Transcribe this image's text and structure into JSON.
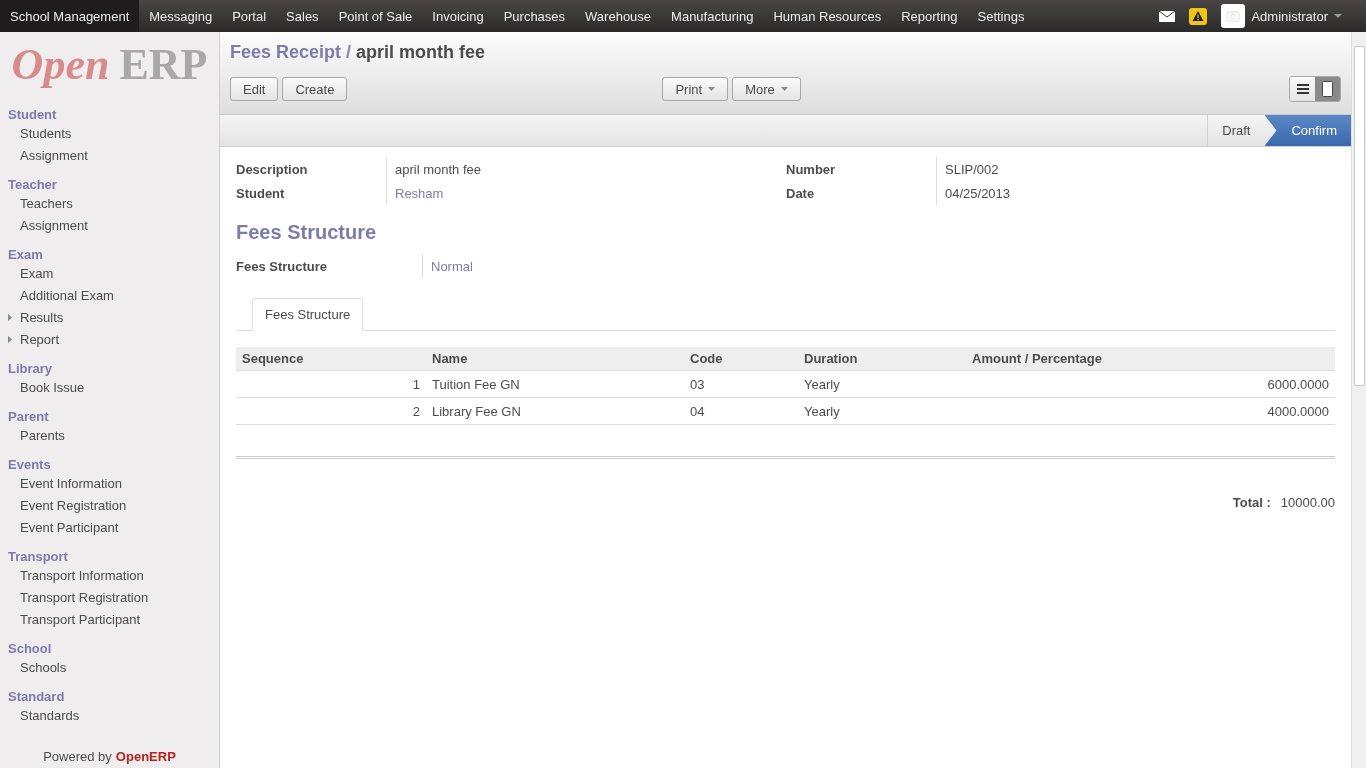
{
  "top_menu": [
    {
      "label": "School Management",
      "selected": true
    },
    {
      "label": "Messaging",
      "selected": false
    },
    {
      "label": "Portal",
      "selected": false
    },
    {
      "label": "Sales",
      "selected": false
    },
    {
      "label": "Point of Sale",
      "selected": false
    },
    {
      "label": "Invoicing",
      "selected": false
    },
    {
      "label": "Purchases",
      "selected": false
    },
    {
      "label": "Warehouse",
      "selected": false
    },
    {
      "label": "Manufacturing",
      "selected": false
    },
    {
      "label": "Human Resources",
      "selected": false
    },
    {
      "label": "Reporting",
      "selected": false
    },
    {
      "label": "Settings",
      "selected": false
    }
  ],
  "user": {
    "name": "Administrator"
  },
  "sidebar": {
    "logo_a": "Open",
    "logo_b": "ERP",
    "sections": [
      {
        "title": "Student",
        "items": [
          {
            "label": "Students",
            "expandable": false
          },
          {
            "label": "Assignment",
            "expandable": false
          }
        ]
      },
      {
        "title": "Teacher",
        "items": [
          {
            "label": "Teachers",
            "expandable": false
          },
          {
            "label": "Assignment",
            "expandable": false
          }
        ]
      },
      {
        "title": "Exam",
        "items": [
          {
            "label": "Exam",
            "expandable": false
          },
          {
            "label": "Additional Exam",
            "expandable": false
          },
          {
            "label": "Results",
            "expandable": true
          },
          {
            "label": "Report",
            "expandable": true
          }
        ]
      },
      {
        "title": "Library",
        "items": [
          {
            "label": "Book Issue",
            "expandable": false
          }
        ]
      },
      {
        "title": "Parent",
        "items": [
          {
            "label": "Parents",
            "expandable": false
          }
        ]
      },
      {
        "title": "Events",
        "items": [
          {
            "label": "Event Information",
            "expandable": false
          },
          {
            "label": "Event Registration",
            "expandable": false
          },
          {
            "label": "Event Participant",
            "expandable": false
          }
        ]
      },
      {
        "title": "Transport",
        "items": [
          {
            "label": "Transport Information",
            "expandable": false
          },
          {
            "label": "Transport Registration",
            "expandable": false
          },
          {
            "label": "Transport Participant",
            "expandable": false
          }
        ]
      },
      {
        "title": "School",
        "items": [
          {
            "label": "Schools",
            "expandable": false
          }
        ]
      },
      {
        "title": "Standard",
        "items": [
          {
            "label": "Standards",
            "expandable": false
          }
        ]
      }
    ],
    "footer_a": "Powered by",
    "footer_b": "OpenERP"
  },
  "breadcrumb": {
    "parent": "Fees Receipt",
    "separator": "/",
    "current": "april month fee"
  },
  "buttons_left": [
    "Edit",
    "Create"
  ],
  "buttons_mid": [
    "Print",
    "More"
  ],
  "view_switch": [
    {
      "kind": "list",
      "selected": false
    },
    {
      "kind": "form",
      "selected": true
    }
  ],
  "stages": [
    {
      "label": "Draft",
      "selected": false
    },
    {
      "label": "Confirm",
      "selected": true
    }
  ],
  "fields_left": [
    {
      "label": "Description",
      "value": "april month fee",
      "link": false
    },
    {
      "label": "Student",
      "value": "Resham",
      "link": true
    }
  ],
  "fields_right": [
    {
      "label": "Number",
      "value": "SLIP/002",
      "link": false
    },
    {
      "label": "Date",
      "value": "04/25/2013",
      "link": false
    }
  ],
  "section_title": "Fees Structure",
  "structure_field": {
    "label": "Fees Structure",
    "value": "Normal",
    "link": true
  },
  "tabs": [
    {
      "label": "Fees Structure",
      "selected": true
    }
  ],
  "table": {
    "columns": [
      "Sequence",
      "Name",
      "Code",
      "Duration",
      "Amount / Percentage"
    ],
    "rows": [
      [
        "1",
        "Tuition Fee GN",
        "03",
        "Yearly",
        "6000.0000"
      ],
      [
        "2",
        "Library Fee GN",
        "04",
        "Yearly",
        "4000.0000"
      ]
    ]
  },
  "total": {
    "label": "Total :",
    "value": "10000.00"
  }
}
